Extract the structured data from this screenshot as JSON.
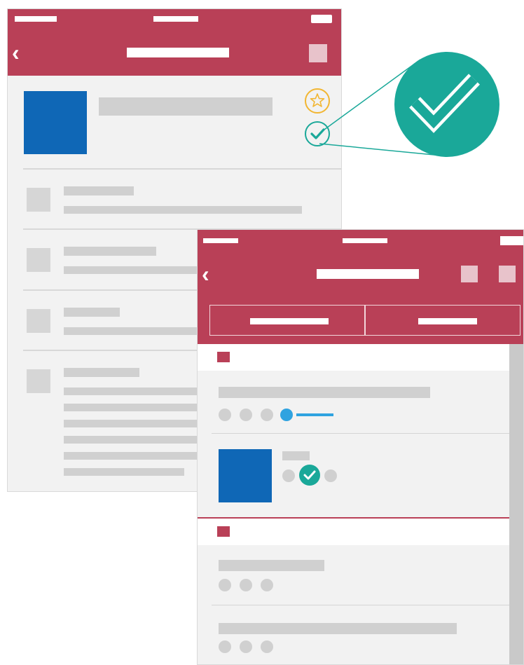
{
  "colors": {
    "accent": "#b94057",
    "teal": "#1aa899",
    "blue": "#0f67b6",
    "gold": "#f2b632",
    "progress": "#2fa3e0"
  },
  "screen1": {
    "back_icon": "chevron-left-icon",
    "action_icon": "square-icon",
    "star_icon": "star-icon",
    "check_icon": "check-icon"
  },
  "zoom_callout": {
    "icon": "check-icon"
  },
  "screen2": {
    "back_icon": "chevron-left-icon",
    "tabs": [
      "tab-1",
      "tab-2"
    ],
    "progress_level": 0.35
  }
}
